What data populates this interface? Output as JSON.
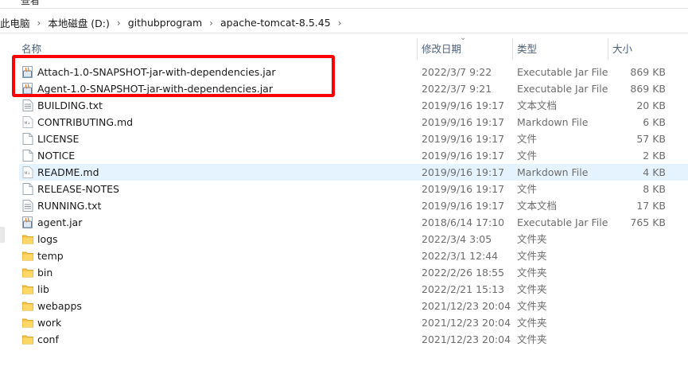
{
  "menu": {
    "view_label": "查看"
  },
  "breadcrumb": [
    "此电脑",
    "本地磁盘 (D:)",
    "githubprogram",
    "apache-tomcat-8.5.45"
  ],
  "columns": {
    "name": "名称",
    "date": "修改日期",
    "type": "类型",
    "size": "大小"
  },
  "files": [
    {
      "name": "Attach-1.0-SNAPSHOT-jar-with-dependencies.jar",
      "date": "2022/3/7 9:22",
      "type": "Executable Jar File",
      "size": "869 KB",
      "icon": "jar-icon"
    },
    {
      "name": "Agent-1.0-SNAPSHOT-jar-with-dependencies.jar",
      "date": "2022/3/7 9:21",
      "type": "Executable Jar File",
      "size": "869 KB",
      "icon": "jar-icon"
    },
    {
      "name": "BUILDING.txt",
      "date": "2019/9/16 19:17",
      "type": "文本文档",
      "size": "20 KB",
      "icon": "text-file-icon"
    },
    {
      "name": "CONTRIBUTING.md",
      "date": "2019/9/16 19:17",
      "type": "Markdown File",
      "size": "6 KB",
      "icon": "markdown-file-icon"
    },
    {
      "name": "LICENSE",
      "date": "2019/9/16 19:17",
      "type": "文件",
      "size": "57 KB",
      "icon": "blank-file-icon"
    },
    {
      "name": "NOTICE",
      "date": "2019/9/16 19:17",
      "type": "文件",
      "size": "2 KB",
      "icon": "blank-file-icon"
    },
    {
      "name": "README.md",
      "date": "2019/9/16 19:17",
      "type": "Markdown File",
      "size": "4 KB",
      "icon": "markdown-file-icon"
    },
    {
      "name": "RELEASE-NOTES",
      "date": "2019/9/16 19:17",
      "type": "文件",
      "size": "8 KB",
      "icon": "blank-file-icon"
    },
    {
      "name": "RUNNING.txt",
      "date": "2019/9/16 19:17",
      "type": "文本文档",
      "size": "17 KB",
      "icon": "text-file-icon"
    },
    {
      "name": "agent.jar",
      "date": "2018/6/14 17:10",
      "type": "Executable Jar File",
      "size": "765 KB",
      "icon": "jar-icon"
    },
    {
      "name": "logs",
      "date": "2022/3/4 3:05",
      "type": "文件夹",
      "size": "",
      "icon": "folder-icon"
    },
    {
      "name": "temp",
      "date": "2022/3/1 12:44",
      "type": "文件夹",
      "size": "",
      "icon": "folder-icon"
    },
    {
      "name": "bin",
      "date": "2022/2/26 18:55",
      "type": "文件夹",
      "size": "",
      "icon": "folder-icon"
    },
    {
      "name": "lib",
      "date": "2022/2/21 15:13",
      "type": "文件夹",
      "size": "",
      "icon": "folder-icon"
    },
    {
      "name": "webapps",
      "date": "2021/12/23 20:04",
      "type": "文件夹",
      "size": "",
      "icon": "folder-icon"
    },
    {
      "name": "work",
      "date": "2021/12/23 20:04",
      "type": "文件夹",
      "size": "",
      "icon": "folder-icon"
    },
    {
      "name": "conf",
      "date": "2021/12/23 20:04",
      "type": "文件夹",
      "size": "",
      "icon": "folder-icon"
    }
  ],
  "hovered_row": "README.md",
  "colors": {
    "highlight_box": "#ff0000",
    "hover_row": "#e5f3ff",
    "folder": "#f5c349",
    "header_text": "#4c607a"
  }
}
